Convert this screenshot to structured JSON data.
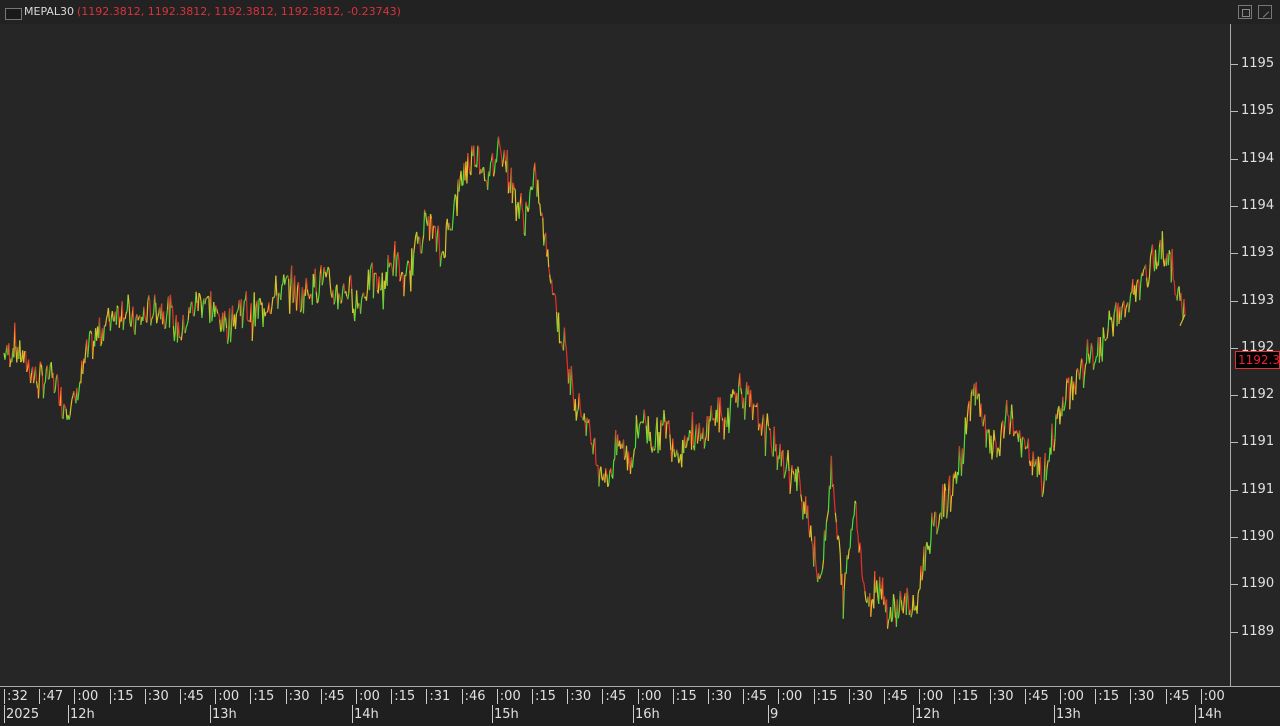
{
  "header": {
    "symbol": "MEPAL30",
    "values": "(1192.3812, 1192.3812, 1192.3812, 1192.3812, -0.23743)"
  },
  "price_tag": "1192.3",
  "colors": {
    "up": "#47e03a",
    "down": "#e8302a",
    "mid": "#d9c22a",
    "background": "#262626"
  },
  "chart_data": {
    "type": "line",
    "title": "",
    "y_tick_labels": [
      "1195",
      "1195",
      "1194",
      "1194",
      "1193",
      "1193",
      "1192",
      "1192",
      "1191",
      "1191",
      "1190",
      "1190",
      "1189"
    ],
    "ylim": [
      1188.8,
      1195.4
    ],
    "x_tick_labels": [
      ":32",
      ":47",
      ":00",
      ":15",
      ":30",
      ":45",
      ":00",
      ":15",
      ":30",
      ":45",
      ":00",
      ":15",
      ":31",
      ":46",
      ":00",
      ":15",
      ":30",
      ":45",
      ":00",
      ":15",
      ":30",
      ":45",
      ":00",
      ":15",
      ":30",
      ":45",
      ":00",
      ":15",
      ":30",
      ":45",
      ":00",
      ":15",
      ":30",
      ":45",
      ":00"
    ],
    "day_labels": [
      "2025",
      "12h",
      "13h",
      "14h",
      "15h",
      "16h",
      "9",
      "12h",
      "13h",
      "14h"
    ],
    "grid": false,
    "legend": "none",
    "series": [
      {
        "values": [
          1192.1,
          1192.2,
          1192.0,
          1191.8,
          1191.9,
          1191.6,
          1191.6,
          1192.1,
          1192.3,
          1192.5,
          1192.6,
          1192.4,
          1192.5,
          1192.6,
          1192.5,
          1192.3,
          1192.6,
          1192.7,
          1192.5,
          1192.4,
          1192.6,
          1192.5,
          1192.6,
          1192.7,
          1192.8,
          1192.7,
          1192.8,
          1192.9,
          1192.7,
          1192.8,
          1192.6,
          1192.9,
          1192.8,
          1193.1,
          1192.8,
          1193.3,
          1193.5,
          1193.1,
          1193.6,
          1194.0,
          1194.2,
          1193.9,
          1194.3,
          1193.8,
          1193.5,
          1193.9,
          1193.1,
          1192.4,
          1191.8,
          1191.5,
          1191.1,
          1190.8,
          1191.2,
          1191.0,
          1191.5,
          1191.2,
          1191.4,
          1191.1,
          1191.3,
          1191.2,
          1191.5,
          1191.4,
          1191.8,
          1191.6,
          1191.4,
          1191.2,
          1191.0,
          1190.8,
          1190.5,
          1189.7,
          1190.9,
          1189.6,
          1190.6,
          1189.5,
          1189.8,
          1189.4,
          1189.6,
          1189.4,
          1190.1,
          1190.4,
          1190.7,
          1191.0,
          1191.8,
          1191.3,
          1191.1,
          1191.5,
          1191.2,
          1191.0,
          1190.8,
          1191.4,
          1191.7,
          1191.9,
          1192.1,
          1192.2,
          1192.5,
          1192.6,
          1192.8,
          1193.0,
          1193.2,
          1192.9,
          1192.4
        ]
      }
    ]
  }
}
